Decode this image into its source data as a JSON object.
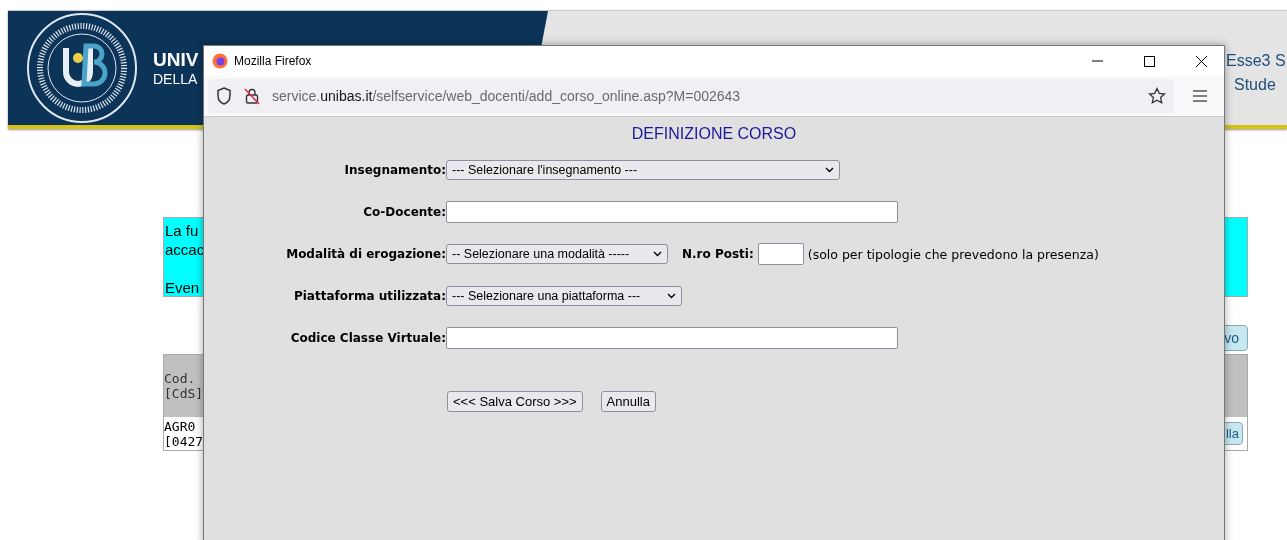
{
  "background_page": {
    "header": {
      "title_lines": [
        "UNIV",
        "DELLA"
      ],
      "right_lines": [
        "Esse3 S",
        "Stude"
      ]
    },
    "notice": {
      "lines": [
        "La fu",
        "accac",
        "Even"
      ]
    },
    "top_button": "vo",
    "table": {
      "header_lines": [
        "Cod.",
        "[CdS]"
      ],
      "row_lines": [
        "AGR0",
        "[0427"
      ],
      "row_button": "lla"
    }
  },
  "popup": {
    "window": {
      "title": "Mozilla Firefox"
    },
    "address_bar": {
      "prefix": "service.",
      "domain": "unibas.it",
      "path": "/selfservice/web_docenti/add_corso_online.asp?M=002643"
    },
    "form": {
      "title": "DEFINIZIONE CORSO",
      "fields": [
        {
          "kind": "select",
          "label": "Insegnamento:",
          "value": "--- Selezionare l'insegnamento ---"
        },
        {
          "kind": "text",
          "label": "Co-Docente:"
        },
        {
          "kind": "select",
          "label": "Modalità di erogazione:",
          "value": "-- Selezionare una modalità -----",
          "extra": {
            "label": "N.ro Posti:",
            "note": "(solo per tipologie che prevedono la presenza)"
          }
        },
        {
          "kind": "select",
          "label": "Piattaforma utilizzata:",
          "value": "--- Selezionare una piattaforma ---"
        },
        {
          "kind": "text",
          "label": "Codice Classe Virtuale:"
        }
      ],
      "buttons": [
        "<<< Salva Corso >>>",
        "Annulla"
      ]
    }
  }
}
